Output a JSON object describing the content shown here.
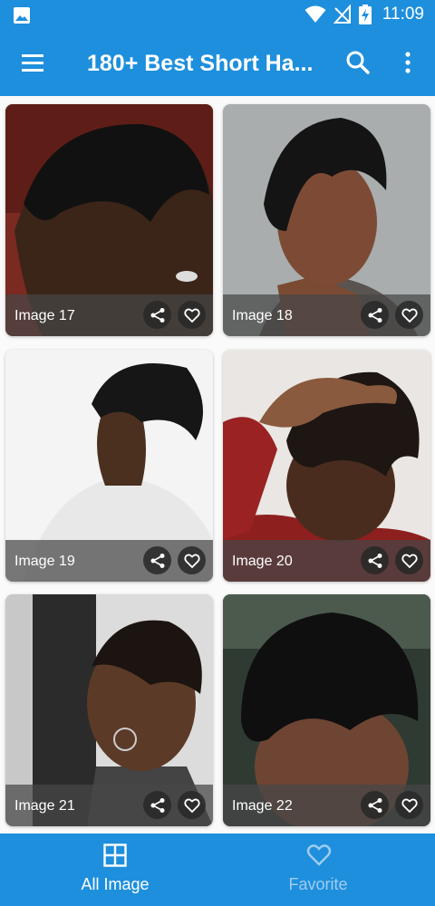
{
  "status_bar": {
    "time": "11:09",
    "icons": [
      "gallery-icon",
      "wifi-icon",
      "no-signal-icon",
      "battery-charging-icon"
    ]
  },
  "app_bar": {
    "title": "180+ Best Short Ha...",
    "icons": [
      "menu-icon",
      "search-icon",
      "more-vert-icon"
    ],
    "color": "#1e8fdc"
  },
  "cards": [
    {
      "caption": "Image 17"
    },
    {
      "caption": "Image 18"
    },
    {
      "caption": "Image 19"
    },
    {
      "caption": "Image 20"
    },
    {
      "caption": "Image 21"
    },
    {
      "caption": "Image 22"
    }
  ],
  "card_actions": [
    "share-icon",
    "heart-outline-icon"
  ],
  "bottom_nav": {
    "items": [
      {
        "label": "All Image",
        "icon": "grid-icon",
        "active": true
      },
      {
        "label": "Favorite",
        "icon": "heart-outline-icon",
        "active": false
      }
    ],
    "active_color": "#ffffff",
    "inactive_color": "#9fcdf0"
  }
}
